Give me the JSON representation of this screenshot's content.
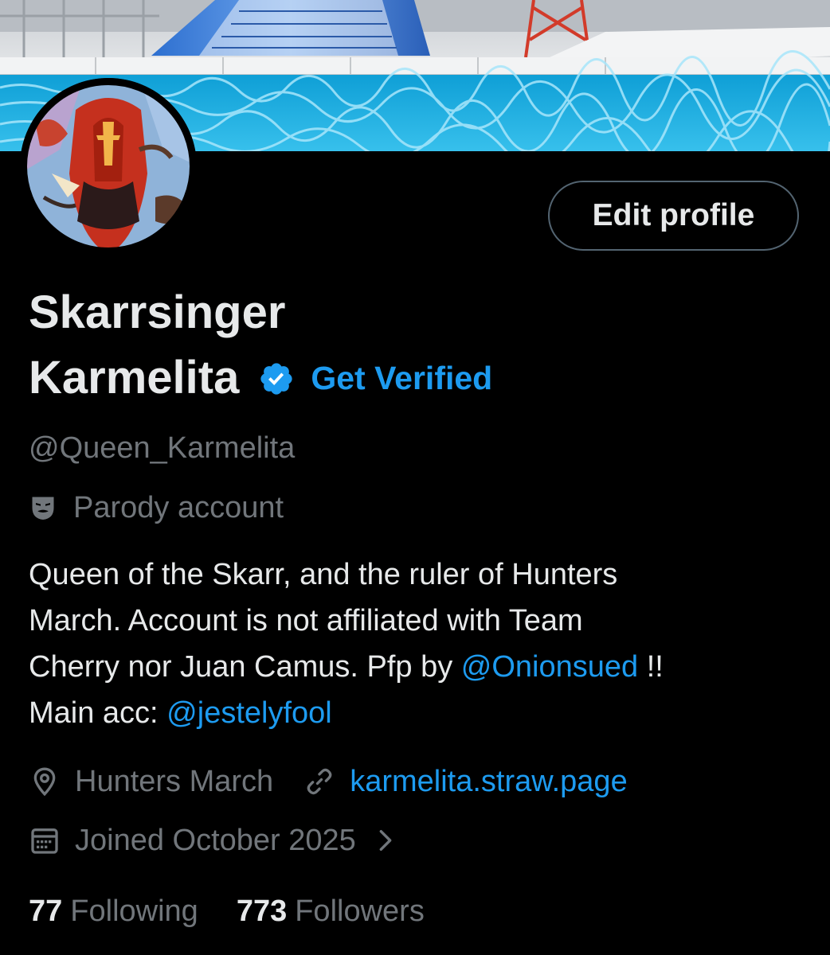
{
  "banner": {
    "description_icon": "pool-banner-image"
  },
  "avatar": {
    "icon": "avatar-image"
  },
  "profile": {
    "name_line1": "Skarrsinger",
    "name_line2": "Karmelita",
    "get_verified": "Get Verified",
    "handle": "@Queen_Karmelita",
    "parody_label": "Parody account",
    "edit_profile": "Edit profile"
  },
  "bio": {
    "line1": "Queen of the Skarr, and the ruler of Hunters",
    "line2": "March.  Account is not affiliated with Team",
    "line3_pre": "Cherry nor Juan Camus.  Pfp by ",
    "line3_link": "@Onionsued",
    "line3_post": " !!",
    "line4_pre": "Main acc: ",
    "line4_link": "@jestelyfool"
  },
  "meta": {
    "location": "Hunters March",
    "website": "karmelita.straw.page",
    "joined": "Joined October 2025"
  },
  "stats": {
    "following_count": "77",
    "following_label": "Following",
    "followers_count": "773",
    "followers_label": "Followers"
  },
  "colors": {
    "accent": "#1d9bf0",
    "muted": "#71767b",
    "text": "#e7e9ea",
    "background": "#000000"
  }
}
